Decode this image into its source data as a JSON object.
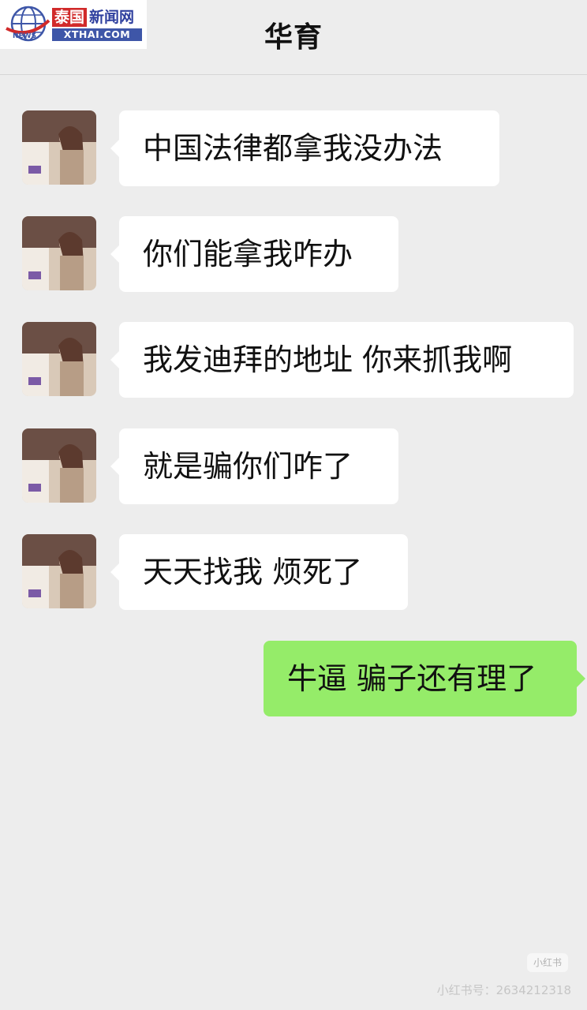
{
  "header": {
    "title": "华育"
  },
  "logo": {
    "globe_text": "NEWS",
    "cn_part_a": "泰国",
    "cn_part_b": "新闻网",
    "domain": "XTHAI.COM"
  },
  "messages": [
    {
      "sender": "contact",
      "text": "中国法律都拿我没办法"
    },
    {
      "sender": "contact",
      "text": "你们能拿我咋办"
    },
    {
      "sender": "contact",
      "text": "我发迪拜的地址 你来抓我啊"
    },
    {
      "sender": "contact",
      "text": "就是骗你们咋了"
    },
    {
      "sender": "contact",
      "text": "天天找我 烦死了"
    },
    {
      "sender": "me",
      "text": "牛逼 骗子还有理了"
    }
  ],
  "watermark": {
    "brand": "小红书",
    "id_text": "小红书号：2634212318"
  },
  "colors": {
    "background": "#ededed",
    "incoming_bubble": "#ffffff",
    "outgoing_bubble": "#95ec69",
    "logo_red": "#d12a2a",
    "logo_blue": "#3e56a8"
  }
}
